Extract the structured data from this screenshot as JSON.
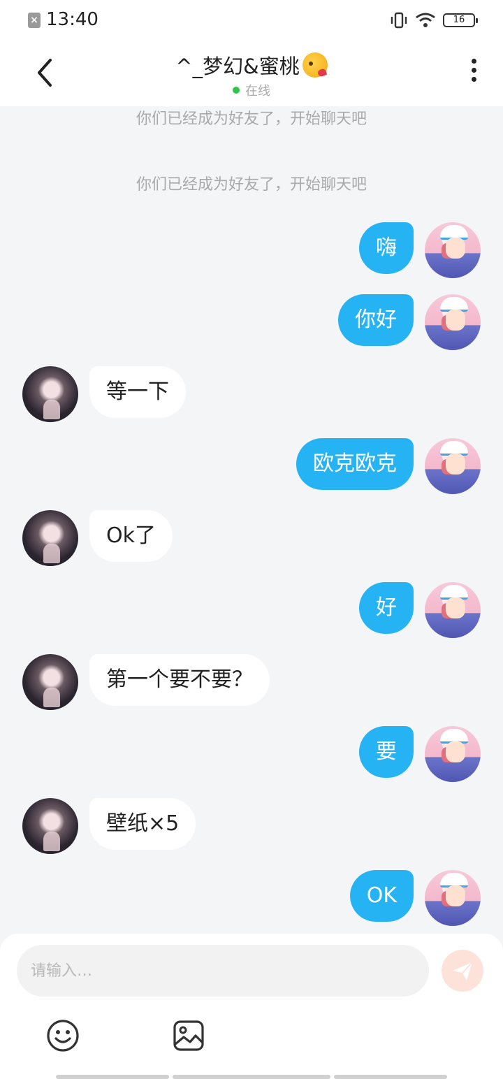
{
  "status_bar": {
    "time": "13:40",
    "battery": "16",
    "icons": [
      "notification-icon",
      "vibrate-icon",
      "wifi-icon",
      "battery-icon"
    ]
  },
  "header": {
    "title": "^_梦幻&蜜桃",
    "title_emoji_icon": "kissing-face-emoji",
    "status": "在线",
    "online_color": "#2dc54a",
    "back_icon": "back-chevron-icon",
    "more_icon": "more-vertical-icon"
  },
  "chat": {
    "system_messages": [
      "你们已经成为好友了，开始聊天吧",
      "你们已经成为好友了，开始聊天吧"
    ],
    "messages": [
      {
        "sender": "me",
        "text": "嗨"
      },
      {
        "sender": "me",
        "text": "你好"
      },
      {
        "sender": "peer",
        "text": "等一下"
      },
      {
        "sender": "me",
        "text": "欧克欧克"
      },
      {
        "sender": "peer",
        "text": "Ok了"
      },
      {
        "sender": "me",
        "text": "好"
      },
      {
        "sender": "peer",
        "text": "第一个要不要？"
      },
      {
        "sender": "me",
        "text": "要"
      },
      {
        "sender": "peer",
        "text": "壁纸×5"
      },
      {
        "sender": "me",
        "text": "OK"
      }
    ]
  },
  "input": {
    "placeholder": "请输入…",
    "value": "",
    "send_icon": "send-icon",
    "toolbar_icons": [
      "emoji-icon",
      "image-icon"
    ]
  },
  "colors": {
    "accent": "#26b3f4",
    "send_button": "#fde2da",
    "background": "#f4f5f7"
  }
}
